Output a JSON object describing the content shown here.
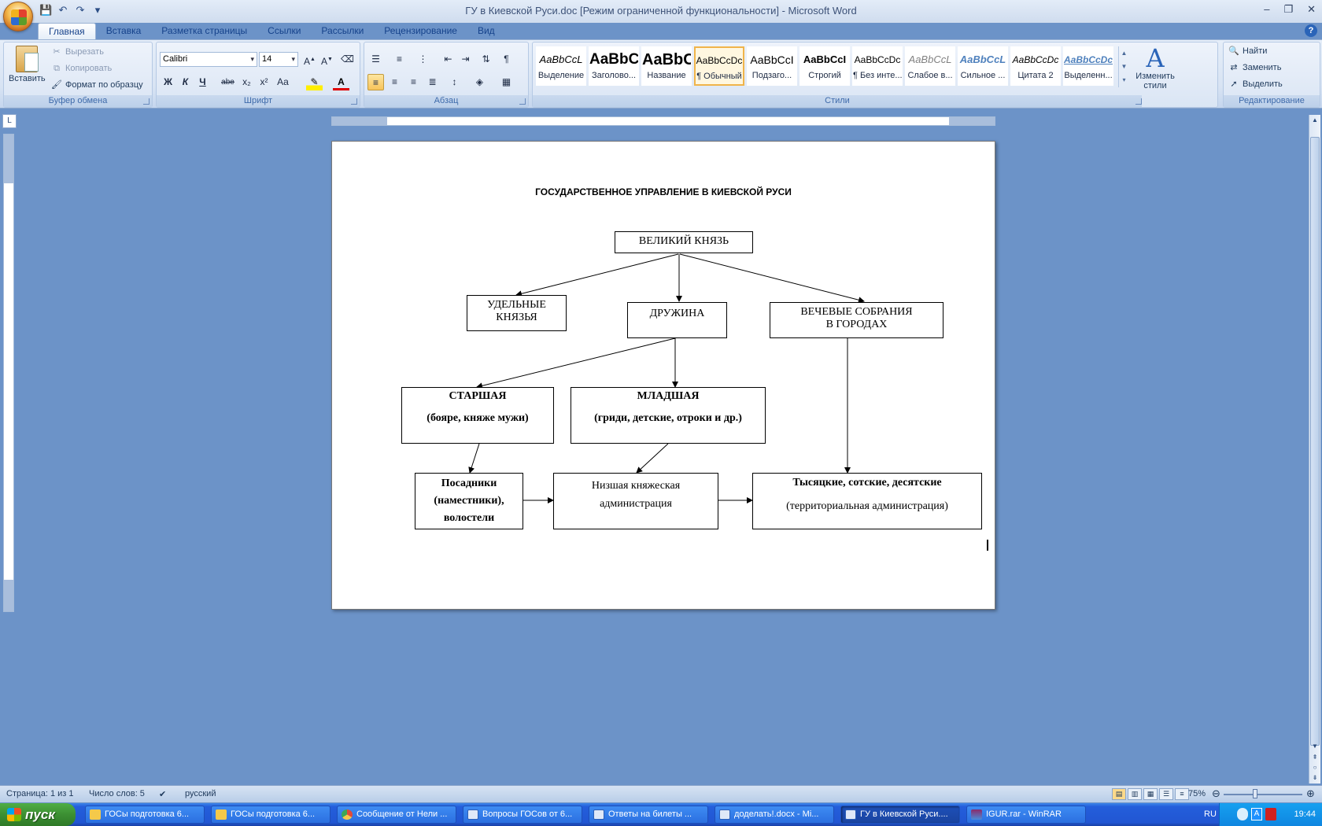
{
  "window": {
    "title": "ГУ в Киевской Руси.doc [Режим ограниченной функциональности] - Microsoft Word",
    "controls": [
      "–",
      "❐",
      "✕"
    ]
  },
  "ribbon": {
    "tabs": [
      "Главная",
      "Вставка",
      "Разметка страницы",
      "Ссылки",
      "Рассылки",
      "Рецензирование",
      "Вид"
    ],
    "active_tab": "Главная",
    "clipboard": {
      "paste": "Вставить",
      "cut": "Вырезать",
      "copy": "Копировать",
      "format_painter": "Формат по образцу",
      "label": "Буфер обмена"
    },
    "font": {
      "family": "Calibri",
      "size": "14",
      "label": "Шрифт",
      "bold": "Ж",
      "italic": "К",
      "underline": "Ч",
      "strike": "abe",
      "subscript": "x₂",
      "superscript": "x²",
      "case": "Aa"
    },
    "paragraph": {
      "label": "Абзац"
    },
    "styles": {
      "label": "Стили",
      "items": [
        {
          "preview": "AaBbCcL",
          "name": "Выделение"
        },
        {
          "preview": "AaBbC",
          "name": "Заголово..."
        },
        {
          "preview": "AaBbC",
          "name": "Название"
        },
        {
          "preview": "AaBbCcDc",
          "name": "¶ Обычный"
        },
        {
          "preview": "AaBbCcI",
          "name": "Подзаго..."
        },
        {
          "preview": "AaBbCcI",
          "name": "Строгий"
        },
        {
          "preview": "AaBbCcDc",
          "name": "¶ Без инте..."
        },
        {
          "preview": "AaBbCcL",
          "name": "Слабое в..."
        },
        {
          "preview": "AaBbCcL",
          "name": "Сильное ..."
        },
        {
          "preview": "AaBbCcDc",
          "name": "Цитата 2"
        },
        {
          "preview": "AaBbCcDc",
          "name": "Выделенн..."
        }
      ],
      "change_styles": "Изменить стили"
    },
    "editing": {
      "label": "Редактирование",
      "find": "Найти",
      "replace": "Заменить",
      "select": "Выделить"
    }
  },
  "document": {
    "title": "ГОСУДАРСТВЕННОЕ УПРАВЛЕНИЕ В КИЕВСКОЙ РУСИ",
    "nodes": {
      "grand_prince": "ВЕЛИКИЙ КНЯЗЬ",
      "appanage_l1": "УДЕЛЬНЫЕ",
      "appanage_l2": "КНЯЗЬЯ",
      "druzhina": "ДРУЖИНА",
      "veche_l1": "ВЕЧЕВЫЕ СОБРАНИЯ",
      "veche_l2": "В ГОРОДАХ",
      "senior_l1": "СТАРШАЯ",
      "senior_l2": "(бояре, княже мужи)",
      "junior_l1": "МЛАДШАЯ",
      "junior_l2": "(гриди, детские, отроки и др.)",
      "posadniki_l1": "Посадники",
      "posadniki_l2": "(наместники),",
      "posadniki_l3": "волостели",
      "lower_admin_l1": "Низшая княжеская",
      "lower_admin_l2": "администрация",
      "thousands_l1": "Тысяцкие, сотские, десятские",
      "thousands_l2": "(территориальная администрация)"
    }
  },
  "statusbar": {
    "page": "Страница: 1 из 1",
    "words": "Число слов: 5",
    "language": "русский",
    "zoom": "75%"
  },
  "taskbar": {
    "start": "пуск",
    "tasks": [
      {
        "label": "ГОСы подготовка 6...",
        "icon": "folder-icon",
        "color": "#f5c94a"
      },
      {
        "label": "ГОСы подготовка 6...",
        "icon": "folder-icon",
        "color": "#f5c94a"
      },
      {
        "label": "Сообщение от Нели ...",
        "icon": "chrome-icon",
        "color": "#e04a3a"
      },
      {
        "label": "Вопросы ГОСов от 6...",
        "icon": "word-icon",
        "color": "#2b5fb8"
      },
      {
        "label": "Ответы на билеты ...",
        "icon": "word-icon",
        "color": "#2b5fb8"
      },
      {
        "label": "доделать!.docx - Mi...",
        "icon": "word-icon",
        "color": "#2b5fb8"
      },
      {
        "label": "ГУ в Киевской Руси....",
        "icon": "word-icon",
        "color": "#2b5fb8"
      },
      {
        "label": "IGUR.rar - WinRAR",
        "icon": "winrar-icon",
        "color": "#8b2b6b"
      }
    ],
    "tray_lang": "RU",
    "clock": "19:44"
  }
}
